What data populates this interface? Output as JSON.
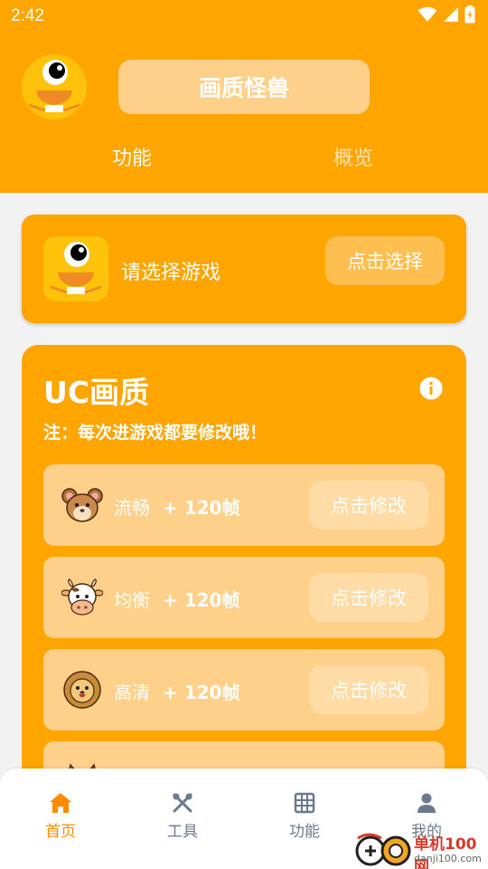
{
  "status_bar": {
    "time": "2:42"
  },
  "header": {
    "title": "画质怪兽",
    "tabs": [
      {
        "label": "功能",
        "active": true
      },
      {
        "label": "概览",
        "active": false
      }
    ]
  },
  "game_select": {
    "prompt": "请选择游戏",
    "button_label": "点击选择"
  },
  "uc_card": {
    "title": "UC画质",
    "note": "注：每次进游戏都要修改哦！",
    "modes": [
      {
        "name": "流畅",
        "fps": "+ 120帧",
        "button_label": "点击修改",
        "icon": "hamster-icon"
      },
      {
        "name": "均衡",
        "fps": "+ 120帧",
        "button_label": "点击修改",
        "icon": "cow-icon"
      },
      {
        "name": "高清",
        "fps": "+ 120帧",
        "button_label": "点击修改",
        "icon": "lion-icon"
      },
      {
        "name": "",
        "fps": "",
        "button_label": "",
        "icon": "fox-icon"
      }
    ]
  },
  "bottom_nav": [
    {
      "label": "首页",
      "icon": "home-icon",
      "active": true
    },
    {
      "label": "工具",
      "icon": "tools-icon",
      "active": false
    },
    {
      "label": "功能",
      "icon": "grid-icon",
      "active": false
    },
    {
      "label": "我的",
      "icon": "user-icon",
      "active": false
    }
  ],
  "watermark": {
    "name": "单机100网",
    "url": "danji100.com"
  },
  "colors": {
    "accent": "#FFA500",
    "light": "#FFD08A",
    "nav_active": "#FF8A00"
  }
}
